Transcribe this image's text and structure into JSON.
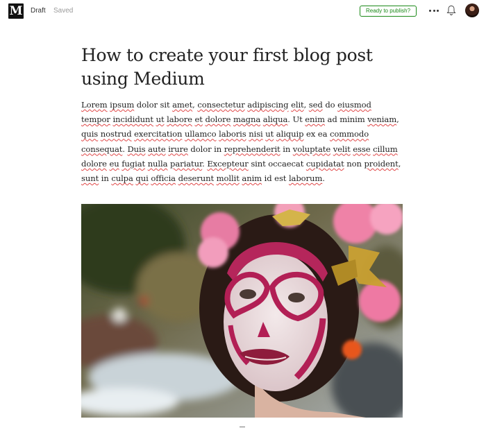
{
  "header": {
    "logo_letter": "M",
    "status": "Draft",
    "save_state": "Saved",
    "publish_label": "Ready to publish?",
    "more_icon": "more-horizontal-icon",
    "bell_icon": "bell-icon",
    "accent_color": "#1a8917"
  },
  "article": {
    "title": "How to create your first blog post using Medium",
    "body_segments": [
      {
        "t": "Lorem",
        "spell": true
      },
      {
        "t": " "
      },
      {
        "t": "ipsum",
        "spell": true
      },
      {
        "t": " dolor sit "
      },
      {
        "t": "amet",
        "spell": true
      },
      {
        "t": ", "
      },
      {
        "t": "consectetur",
        "spell": true
      },
      {
        "t": " "
      },
      {
        "t": "adipiscing",
        "spell": true
      },
      {
        "t": " "
      },
      {
        "t": "elit",
        "spell": true
      },
      {
        "t": ", "
      },
      {
        "t": "sed",
        "spell": true
      },
      {
        "t": " do "
      },
      {
        "t": "eiusmod",
        "spell": true
      },
      {
        "t": " "
      },
      {
        "t": "tempor",
        "spell": true
      },
      {
        "t": " "
      },
      {
        "t": "incididunt",
        "spell": true
      },
      {
        "t": " "
      },
      {
        "t": "ut",
        "spell": true
      },
      {
        "t": " "
      },
      {
        "t": "labore",
        "spell": true
      },
      {
        "t": " "
      },
      {
        "t": "et",
        "spell": true
      },
      {
        "t": " "
      },
      {
        "t": "dolore",
        "spell": true
      },
      {
        "t": " "
      },
      {
        "t": "magna",
        "spell": true
      },
      {
        "t": " "
      },
      {
        "t": "aliqua",
        "spell": true
      },
      {
        "t": ". Ut "
      },
      {
        "t": "enim",
        "spell": true
      },
      {
        "t": " ad minim "
      },
      {
        "t": "veniam",
        "spell": true
      },
      {
        "t": ", "
      },
      {
        "t": "quis",
        "spell": true
      },
      {
        "t": " "
      },
      {
        "t": "nostrud",
        "spell": true
      },
      {
        "t": " "
      },
      {
        "t": "exercitation",
        "spell": true
      },
      {
        "t": " "
      },
      {
        "t": "ullamco",
        "spell": true
      },
      {
        "t": " "
      },
      {
        "t": "laboris",
        "spell": true
      },
      {
        "t": " "
      },
      {
        "t": "nisi",
        "spell": true
      },
      {
        "t": " "
      },
      {
        "t": "ut",
        "spell": true
      },
      {
        "t": " "
      },
      {
        "t": "aliquip",
        "spell": true
      },
      {
        "t": " ex ea "
      },
      {
        "t": "commodo",
        "spell": true
      },
      {
        "t": " "
      },
      {
        "t": "consequat",
        "spell": true
      },
      {
        "t": ". "
      },
      {
        "t": "Duis",
        "spell": true
      },
      {
        "t": " "
      },
      {
        "t": "aute",
        "spell": true
      },
      {
        "t": " "
      },
      {
        "t": "irure",
        "spell": true
      },
      {
        "t": " dolor in "
      },
      {
        "t": "reprehenderit",
        "spell": true
      },
      {
        "t": " in "
      },
      {
        "t": "voluptate",
        "spell": true
      },
      {
        "t": " "
      },
      {
        "t": "velit",
        "spell": true
      },
      {
        "t": " "
      },
      {
        "t": "esse",
        "spell": true
      },
      {
        "t": " "
      },
      {
        "t": "cillum",
        "spell": true
      },
      {
        "t": " "
      },
      {
        "t": "dolore",
        "spell": true
      },
      {
        "t": " "
      },
      {
        "t": "eu",
        "spell": true
      },
      {
        "t": " "
      },
      {
        "t": "fugiat",
        "spell": true
      },
      {
        "t": " "
      },
      {
        "t": "nulla",
        "spell": true
      },
      {
        "t": " "
      },
      {
        "t": "pariatur",
        "spell": true
      },
      {
        "t": ". "
      },
      {
        "t": "Excepteur",
        "spell": true
      },
      {
        "t": " sint occaecat "
      },
      {
        "t": "cupidatat",
        "spell": true
      },
      {
        "t": " non "
      },
      {
        "t": "proident",
        "spell": true
      },
      {
        "t": ", "
      },
      {
        "t": "sunt",
        "spell": true
      },
      {
        "t": " in "
      },
      {
        "t": "culpa",
        "spell": true
      },
      {
        "t": " "
      },
      {
        "t": "qui",
        "spell": true
      },
      {
        "t": " "
      },
      {
        "t": "officia",
        "spell": true
      },
      {
        "t": " "
      },
      {
        "t": "deserunt",
        "spell": true
      },
      {
        "t": " "
      },
      {
        "t": "mollit",
        "spell": true
      },
      {
        "t": " "
      },
      {
        "t": "anim",
        "spell": true
      },
      {
        "t": " id est "
      },
      {
        "t": "laborum",
        "spell": true
      },
      {
        "t": "."
      }
    ],
    "spellcheck_color": "#e04747"
  }
}
